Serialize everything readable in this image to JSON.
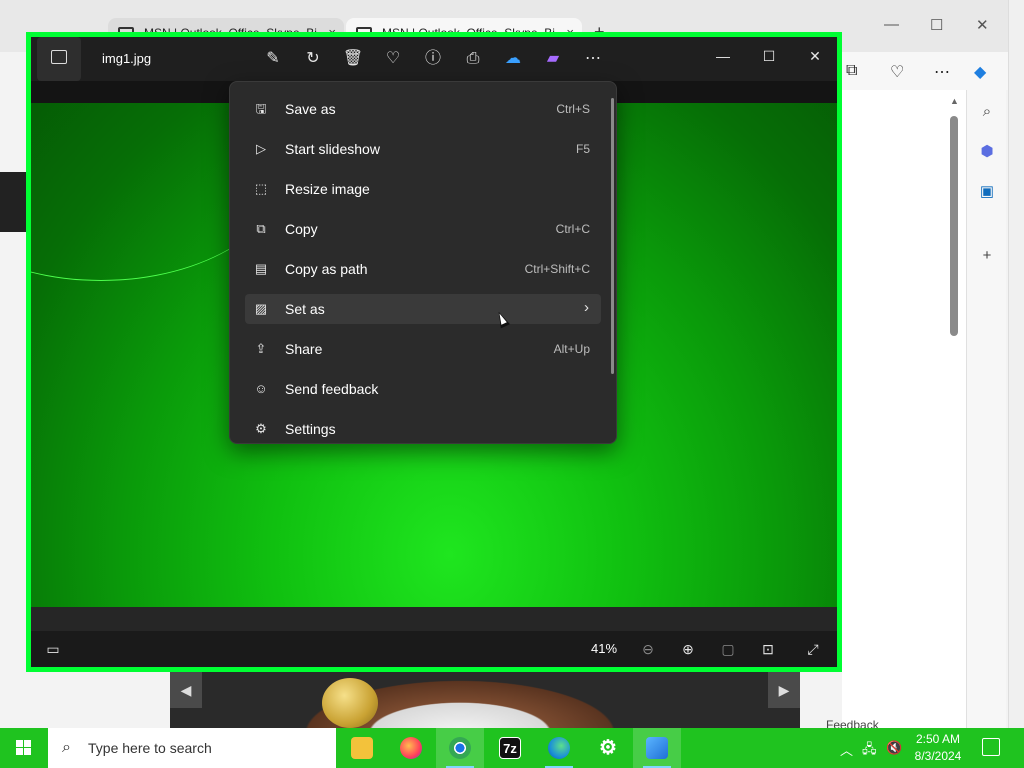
{
  "browser": {
    "tabs": [
      {
        "label": "MSN | Outlook, Office, Skype, Bi"
      },
      {
        "label": "MSN | Outlook, Office, Skype, Bi"
      }
    ],
    "feedback_label": "Feedback"
  },
  "photos": {
    "filename": "img1.jpg",
    "toolbar": [
      {
        "icon": "edit-image-icon"
      },
      {
        "icon": "rotate-icon"
      },
      {
        "icon": "delete-icon"
      },
      {
        "icon": "favorite-heart-icon"
      },
      {
        "icon": "info-icon"
      },
      {
        "icon": "print-icon"
      },
      {
        "icon": "onedrive-icon"
      },
      {
        "icon": "clipchamp-icon"
      },
      {
        "icon": "more-options-icon"
      }
    ],
    "zoom": "41%"
  },
  "menu": {
    "items": [
      {
        "label": "Save as",
        "shortcut": "Ctrl+S",
        "icon": "save-icon"
      },
      {
        "label": "Start slideshow",
        "shortcut": "F5",
        "icon": "slideshow-icon"
      },
      {
        "label": "Resize image",
        "shortcut": "",
        "icon": "resize-icon"
      },
      {
        "label": "Copy",
        "shortcut": "Ctrl+C",
        "icon": "copy-icon"
      },
      {
        "label": "Copy as path",
        "shortcut": "Ctrl+Shift+C",
        "icon": "copy-path-icon"
      },
      {
        "label": "Set as",
        "shortcut": "",
        "icon": "set-as-icon",
        "submenu": true
      },
      {
        "label": "Share",
        "shortcut": "Alt+Up",
        "icon": "share-icon"
      },
      {
        "label": "Send feedback",
        "shortcut": "",
        "icon": "feedback-icon"
      },
      {
        "label": "Settings",
        "shortcut": "",
        "icon": "settings-icon"
      }
    ]
  },
  "taskbar": {
    "search_placeholder": "Type here to search",
    "time": "2:50 AM",
    "date": "8/3/2024",
    "apps": [
      {
        "name": "file-explorer"
      },
      {
        "name": "firefox"
      },
      {
        "name": "chrome"
      },
      {
        "name": "7-zip",
        "label": "7z"
      },
      {
        "name": "edge"
      },
      {
        "name": "settings"
      },
      {
        "name": "photos"
      }
    ]
  },
  "colors": {
    "accent_green": "#00ff33",
    "taskbar_green": "#1fc31f",
    "menu_bg": "#2b2b2b"
  }
}
